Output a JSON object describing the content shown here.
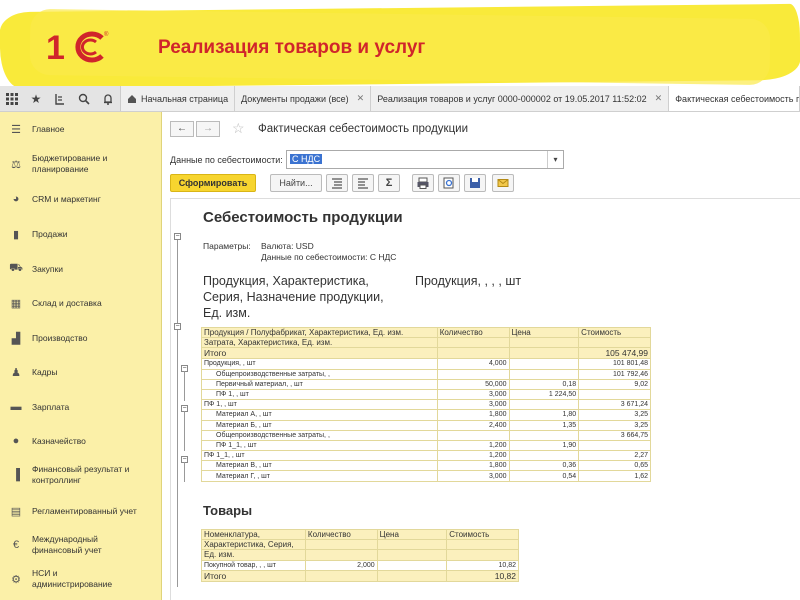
{
  "slide": {
    "title": "Реализация товаров и услуг",
    "logo_text": "1С"
  },
  "toolbar_icons": [
    "grid-icon",
    "star-icon",
    "history-icon",
    "search-icon",
    "bell-icon"
  ],
  "tabs": [
    {
      "label": "Начальная страница",
      "icon": "home-icon",
      "closable": false
    },
    {
      "label": "Документы продажи (все)",
      "closable": true
    },
    {
      "label": "Реализация товаров и услуг 0000-000002 от 19.05.2017 11:52:02",
      "closable": true
    },
    {
      "label": "Фактическая себестоимость продукции",
      "closable": false,
      "active": true
    }
  ],
  "sidebar": {
    "items": [
      {
        "label": "Главное",
        "icon": "menu-icon"
      },
      {
        "label": "Бюджетирование и планирование",
        "icon": "budget-icon"
      },
      {
        "label": "CRM и маркетинг",
        "icon": "pie-icon"
      },
      {
        "label": "Продажи",
        "icon": "bag-icon"
      },
      {
        "label": "Закупки",
        "icon": "cart-icon"
      },
      {
        "label": "Склад и доставка",
        "icon": "warehouse-icon"
      },
      {
        "label": "Производство",
        "icon": "factory-icon"
      },
      {
        "label": "Кадры",
        "icon": "person-icon"
      },
      {
        "label": "Зарплата",
        "icon": "wallet-icon"
      },
      {
        "label": "Казначейство",
        "icon": "coin-icon"
      },
      {
        "label": "Финансовый результат и контроллинг",
        "icon": "bars-icon"
      },
      {
        "label": "Регламентированный учет",
        "icon": "document-icon"
      },
      {
        "label": "Международный финансовый учет",
        "icon": "euro-icon"
      },
      {
        "label": "НСИ и администрирование",
        "icon": "gear-icon"
      }
    ]
  },
  "form": {
    "back": "←",
    "forward": "→",
    "title": "Фактическая себестоимость продукции",
    "param_label": "Данные по себестоимости:",
    "param_value": "С НДС",
    "generate_button": "Сформировать",
    "find_button": "Найти...",
    "sigma": "Σ"
  },
  "report": {
    "title": "Себестоимость продукции",
    "params_label": "Параметры:",
    "param_currency": "Валюта: USD",
    "param_cost": "Данные по себестоимости: С НДС",
    "group_header_1": "Продукция, Характеристика,",
    "group_header_2": "Серия, Назначение продукции,",
    "group_header_3": "Ед. изм.",
    "group_qty_header": "Продукция, , , , шт",
    "table_headers": {
      "name_1": "Продукция / Полуфабрикат, Характеристика, Ед. изм.",
      "name_2": "Затрата, Характеристика, Ед. изм.",
      "qty": "Количество",
      "price": "Цена",
      "cost": "Стоимость"
    },
    "total_label": "Итого",
    "total_value": "105 474,99",
    "rows": [
      {
        "name": "Продукция, , шт",
        "indent": 0,
        "qty": "4,000",
        "price": "",
        "cost": "101 801,48"
      },
      {
        "name": "Общепроизводственные затраты, ,",
        "indent": 2,
        "qty": "",
        "price": "",
        "cost": "101 792,46"
      },
      {
        "name": "Первичный материал, , шт",
        "indent": 2,
        "qty": "50,000",
        "price": "0,18",
        "cost": "9,02"
      },
      {
        "name": "ПФ 1, , шт",
        "indent": 2,
        "qty": "3,000",
        "price": "1 224,50",
        "cost": ""
      },
      {
        "name": "ПФ 1, , шт",
        "indent": 0,
        "qty": "3,000",
        "price": "",
        "cost": "3 671,24"
      },
      {
        "name": "Материал А, , шт",
        "indent": 2,
        "qty": "1,800",
        "price": "1,80",
        "cost": "3,25"
      },
      {
        "name": "Материал Б, , шт",
        "indent": 2,
        "qty": "2,400",
        "price": "1,35",
        "cost": "3,25"
      },
      {
        "name": "Общепроизводственные затраты, ,",
        "indent": 2,
        "qty": "",
        "price": "",
        "cost": "3 664,75"
      },
      {
        "name": "ПФ 1_1, , шт",
        "indent": 2,
        "qty": "1,200",
        "price": "1,90",
        "cost": ""
      },
      {
        "name": "ПФ 1_1, , шт",
        "indent": 0,
        "qty": "1,200",
        "price": "",
        "cost": "2,27"
      },
      {
        "name": "Материал В, , шт",
        "indent": 2,
        "qty": "1,800",
        "price": "0,36",
        "cost": "0,65"
      },
      {
        "name": "Материал Г, , шт",
        "indent": 2,
        "qty": "3,000",
        "price": "0,54",
        "cost": "1,62"
      }
    ],
    "goods_title": "Товары",
    "goods_headers": {
      "name_1": "Номенклатура,",
      "name_2": "Характеристика, Серия,",
      "name_3": "Ед. изм.",
      "qty": "Количество",
      "price": "Цена",
      "cost": "Стоимость"
    },
    "goods_rows": [
      {
        "name": "Покупной товар, , , шт",
        "qty": "2,000",
        "price": "",
        "cost": "10,82"
      }
    ],
    "goods_total_label": "Итого",
    "goods_total_value": "10,82"
  }
}
